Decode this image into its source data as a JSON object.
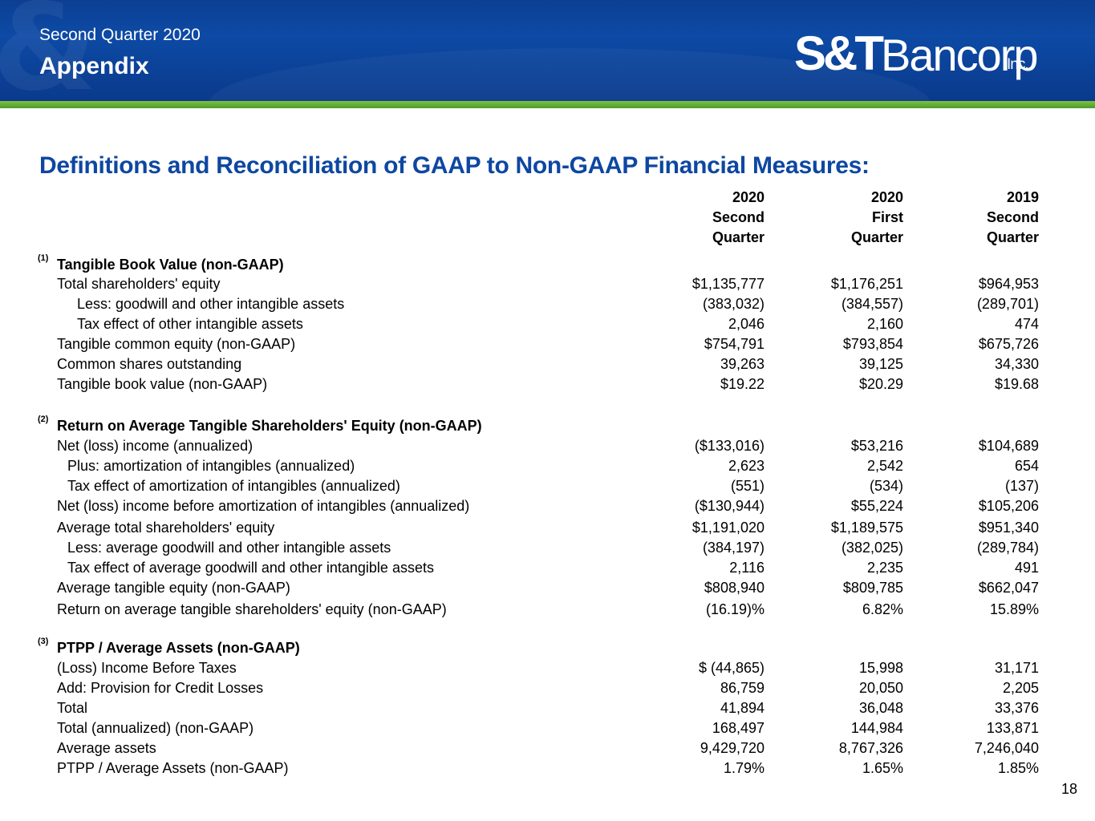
{
  "header": {
    "subtitle": "Second Quarter 2020",
    "title": "Appendix",
    "logo_st": "S&T",
    "logo_name": "Bancorp",
    "logo_inc": "Inc."
  },
  "heading": "Definitions and Reconciliation of GAAP to Non-GAAP Financial Measures:",
  "columns": [
    {
      "year": "2020",
      "line1": "Second",
      "line2": "Quarter"
    },
    {
      "year": "2020",
      "line1": "First",
      "line2": "Quarter"
    },
    {
      "year": "2019",
      "line1": "Second",
      "line2": "Quarter"
    }
  ],
  "sections": [
    {
      "note": "(1)",
      "title": "Tangible Book Value (non-GAAP)",
      "rows": [
        {
          "label": "Total shareholders' equity",
          "v": [
            "$1,135,777",
            "$1,176,251",
            "$964,953"
          ]
        },
        {
          "label": "Less: goodwill and other intangible assets",
          "v": [
            "(383,032)",
            "(384,557)",
            "(289,701)"
          ]
        },
        {
          "label": "Tax effect of other intangible assets",
          "v": [
            "2,046",
            "2,160",
            "474"
          ]
        },
        {
          "label": "Tangible common equity (non-GAAP)",
          "v": [
            "$754,791",
            "$793,854",
            "$675,726"
          ]
        },
        {
          "label": "Common shares outstanding",
          "v": [
            "39,263",
            "39,125",
            "34,330"
          ]
        },
        {
          "label": "Tangible book value (non-GAAP)",
          "v": [
            "$19.22",
            "$20.29",
            "$19.68"
          ]
        }
      ]
    },
    {
      "note": "(2)",
      "title": "Return on Average Tangible Shareholders' Equity (non-GAAP)",
      "rows": [
        {
          "label": "Net (loss) income (annualized)",
          "v": [
            "($133,016)",
            "$53,216",
            "$104,689"
          ]
        },
        {
          "label": "Plus: amortization of intangibles (annualized)",
          "v": [
            "2,623",
            "2,542",
            "654"
          ]
        },
        {
          "label": "Tax effect of amortization of intangibles (annualized)",
          "v": [
            "(551)",
            "(534)",
            "(137)"
          ]
        },
        {
          "label": "Net (loss) income before amortization of intangibles (annualized)",
          "v": [
            "($130,944)",
            "$55,224",
            "$105,206"
          ]
        },
        {
          "label": "Average total shareholders' equity",
          "v": [
            "$1,191,020",
            "$1,189,575",
            "$951,340"
          ]
        },
        {
          "label": "Less: average goodwill and other intangible assets",
          "v": [
            "(384,197)",
            "(382,025)",
            "(289,784)"
          ]
        },
        {
          "label": "Tax effect of average goodwill and other intangible assets",
          "v": [
            "2,116",
            "2,235",
            "491"
          ]
        },
        {
          "label": "Average tangible equity (non-GAAP)",
          "v": [
            "$808,940",
            "$809,785",
            "$662,047"
          ]
        },
        {
          "label": "Return on average tangible shareholders' equity (non-GAAP)",
          "v": [
            "(16.19)%",
            "6.82%",
            "15.89%"
          ]
        }
      ]
    },
    {
      "note": "(3)",
      "title": "PTPP / Average Assets (non-GAAP)",
      "rows": [
        {
          "label": "(Loss) Income Before Taxes",
          "v": [
            "$ (44,865)",
            "15,998",
            "31,171"
          ]
        },
        {
          "label": "Add: Provision for Credit Losses",
          "v": [
            "86,759",
            "20,050",
            "2,205"
          ]
        },
        {
          "label": "Total",
          "v": [
            "41,894",
            "36,048",
            "33,376"
          ]
        },
        {
          "label": "Total (annualized) (non-GAAP)",
          "v": [
            "168,497",
            "144,984",
            "133,871"
          ]
        },
        {
          "label": "Average assets",
          "v": [
            "9,429,720",
            "8,767,326",
            "7,246,040"
          ]
        },
        {
          "label": "PTPP / Average Assets (non-GAAP)",
          "v": [
            "1.79%",
            "1.65%",
            "1.85%"
          ]
        }
      ]
    }
  ],
  "page_number": "18"
}
